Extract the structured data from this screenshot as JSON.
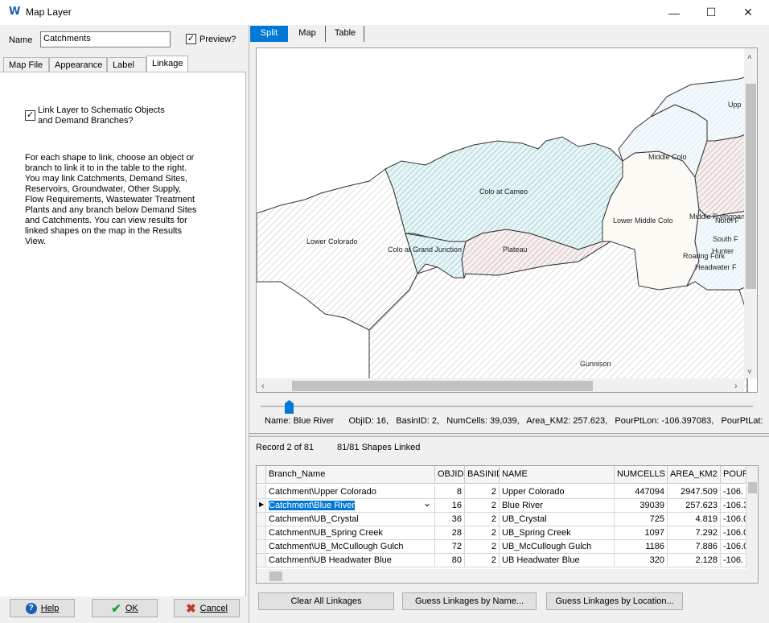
{
  "window": {
    "title": "Map Layer",
    "icon": "W",
    "minimize": "—",
    "maximize": "☐",
    "close": "✕"
  },
  "left": {
    "name_label": "Name",
    "name_value": "Catchments",
    "preview_label": "Preview?",
    "preview_checked": true,
    "tabs": [
      "Map File",
      "Appearance",
      "Label",
      "Linkage"
    ],
    "active_tab": "Linkage",
    "link_label_1": "Link Layer to Schematic Objects",
    "link_label_2": "and Demand Branches?",
    "link_checked": true,
    "description": [
      "For each shape to link, choose an object or",
      "branch to link it to in the table to the right.",
      "You may link Catchments, Demand Sites,",
      "Reservoirs, Groundwater, Other Supply,",
      "Flow Requirements, Wastewater Treatment",
      "Plants and any branch below Demand Sites",
      "and Catchments.  You can view results for",
      "linked shapes on the map in the Results",
      "View."
    ],
    "help_label": "Help",
    "ok_label": "OK",
    "cancel_label": "Cancel"
  },
  "view_tabs": [
    "Split",
    "Map",
    "Table"
  ],
  "active_view": "Split",
  "map": {
    "labels": [
      "Colo at Cameo",
      "Lower Colorado",
      "Colo at Grand Junction",
      "Plateau",
      "Lower Middle Colo",
      "Middle Colo",
      "Upp",
      "Middle Fryingpan",
      "North F",
      "South F",
      "Hunter",
      "Roaring Fork",
      "Headwater F",
      "Gunnison"
    ]
  },
  "info_line": {
    "name": "Name: Blue River",
    "objid": "ObjID: 16,",
    "basinid": "BasinID: 2,",
    "numcells": "NumCells: 39,039,",
    "area": "Area_KM2: 257.623,",
    "pourlon": "PourPtLon: -106.397083,",
    "pourlat": "PourPtLat:"
  },
  "table_status": {
    "record": "Record 2 of 81",
    "linked": "81/81 Shapes Linked"
  },
  "table": {
    "headers": [
      "Branch_Name",
      "OBJID",
      "BASINID",
      "NAME",
      "NUMCELLS",
      "AREA_KM2",
      "POUR"
    ],
    "rows": [
      [
        "Catchment\\Upper Colorado",
        "8",
        "2",
        "Upper Colorado",
        "447094",
        "2947.509",
        "-106."
      ],
      [
        "Catchment\\Blue River",
        "16",
        "2",
        "Blue River",
        "39039",
        "257.623",
        "-106.3"
      ],
      [
        "Catchment\\UB_Crystal",
        "36",
        "2",
        "UB_Crystal",
        "725",
        "4.819",
        "-106.0"
      ],
      [
        "Catchment\\UB_Spring Creek",
        "28",
        "2",
        "UB_Spring Creek",
        "1097",
        "7.292",
        "-106.0"
      ],
      [
        "Catchment\\UB_McCullough Gulch",
        "72",
        "2",
        "UB_McCullough Gulch",
        "1186",
        "7.886",
        "-106.0"
      ],
      [
        "Catchment\\UB Headwater Blue",
        "80",
        "2",
        "UB Headwater Blue",
        "320",
        "2.128",
        "-106."
      ]
    ],
    "selected_row": 1
  },
  "bottom_buttons": {
    "clear": "Clear All Linkages",
    "guess_name": "Guess Linkages by Name...",
    "guess_location": "Guess Linkages by Location..."
  },
  "colors": {
    "accent": "#0078d7",
    "ok_green": "#1e9e3a",
    "cancel_red": "#c0392b",
    "help_blue": "#1a5fb4",
    "highlight": "#0078d7"
  }
}
